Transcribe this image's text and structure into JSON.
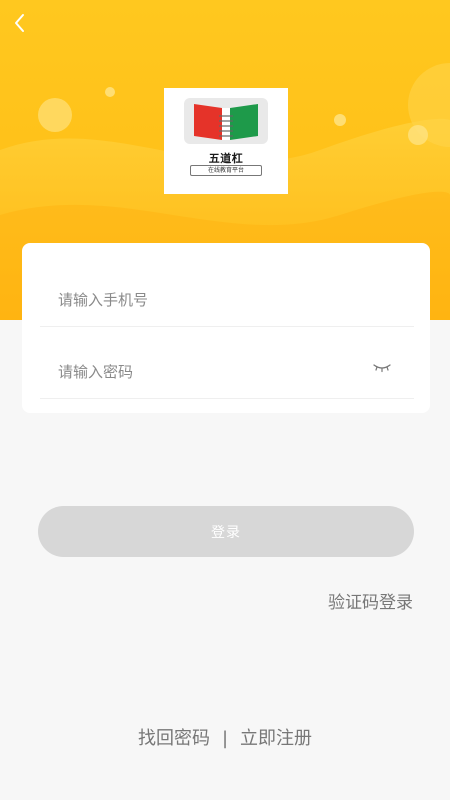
{
  "header": {
    "back_icon": "chevron-left-icon"
  },
  "logo": {
    "title": "五道杠",
    "subtitle": "在线教育平台"
  },
  "form": {
    "phone_placeholder": "请输入手机号",
    "phone_value": "",
    "password_placeholder": "请输入密码",
    "password_value": "",
    "password_toggle_icon": "eye-closed-icon"
  },
  "actions": {
    "login_label": "登录",
    "code_login_label": "验证码登录"
  },
  "footer": {
    "forgot_password_label": "找回密码",
    "separator": "|",
    "register_label": "立即注册"
  },
  "colors": {
    "accent": "#ffc21a",
    "button_disabled": "#d7d7d7",
    "link_text": "#777777"
  }
}
